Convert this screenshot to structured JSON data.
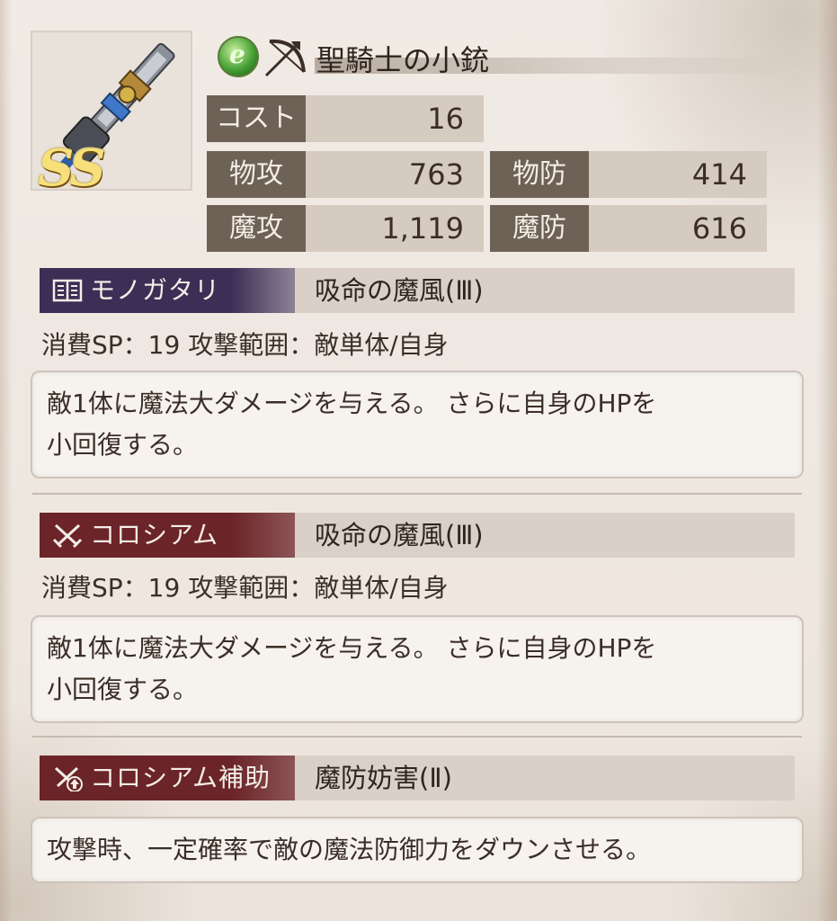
{
  "item": {
    "name": "聖騎士の小銃",
    "rarity": "SS",
    "element_icon": "wind-element-icon",
    "weapon_type_icon": "bow-icon",
    "image_icon": "rifle-weapon-icon"
  },
  "stats": {
    "cost": {
      "label": "コスト",
      "value": "16"
    },
    "phys_atk": {
      "label": "物攻",
      "value": "763"
    },
    "phys_def": {
      "label": "物防",
      "value": "414"
    },
    "mag_atk": {
      "label": "魔攻",
      "value": "1,119"
    },
    "mag_def": {
      "label": "魔防",
      "value": "616"
    }
  },
  "sections": [
    {
      "tag": "モノガタリ",
      "icon": "book-icon",
      "skill": "吸命の魔風(Ⅲ)",
      "meta": "消費SP：19  攻撃範囲：敵単体/自身",
      "desc_line1": "敵1体に魔法大ダメージを与える。 さらに自身のHPを",
      "desc_line2": "小回復する。"
    },
    {
      "tag": "コロシアム",
      "icon": "crossed-swords-icon",
      "skill": "吸命の魔風(Ⅲ)",
      "meta": "消費SP：19  攻撃範囲：敵単体/自身",
      "desc_line1": "敵1体に魔法大ダメージを与える。 さらに自身のHPを",
      "desc_line2": "小回復する。"
    },
    {
      "tag": "コロシアム補助",
      "icon": "crossed-swords-up-icon",
      "skill": "魔防妨害(Ⅱ)",
      "desc_line1": "攻撃時、一定確率で敵の魔法防御力をダウンさせる。"
    }
  ],
  "colors": {
    "stat_label_bg": "#6e6155",
    "stat_value_bg": "#d5cbc1",
    "story_tag": "#3c2e55",
    "colosseum_tag": "#6b2428"
  }
}
